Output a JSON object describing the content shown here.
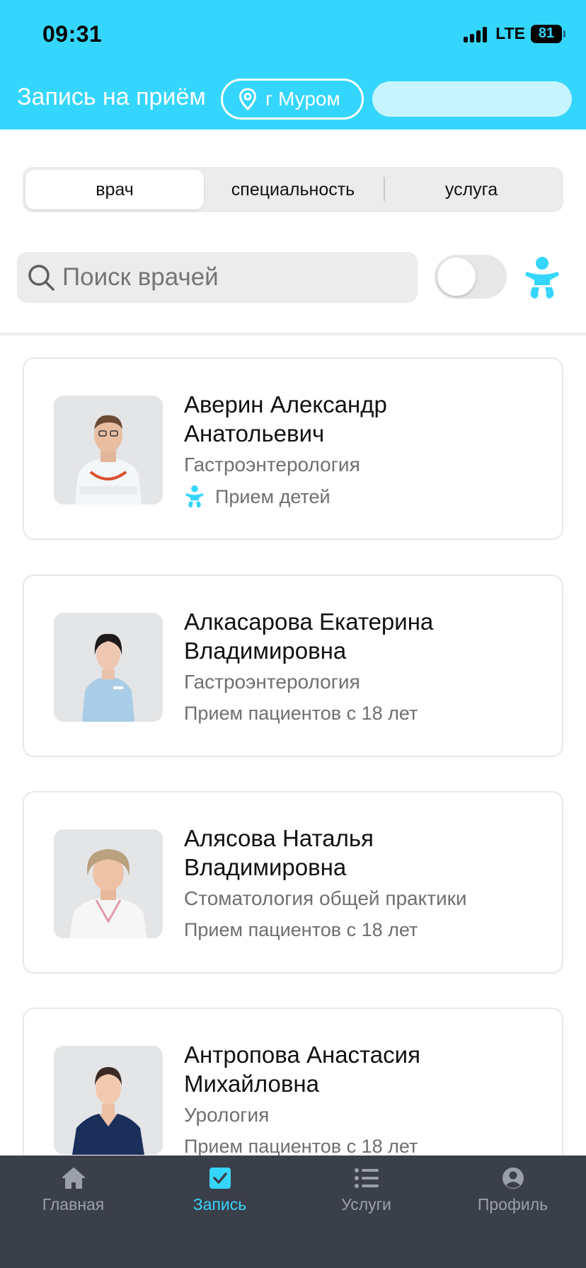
{
  "status": {
    "time": "09:31",
    "network": "LTE",
    "battery": "81"
  },
  "header": {
    "title": "Запись на приём",
    "city": "г Муром"
  },
  "segments": [
    {
      "label": "врач",
      "active": true
    },
    {
      "label": "специальность",
      "active": false
    },
    {
      "label": "услуга",
      "active": false
    }
  ],
  "search": {
    "placeholder": "Поиск врачей",
    "value": ""
  },
  "kids_toggle": {
    "on": false
  },
  "doctors": [
    {
      "name_line1": "Аверин Александр",
      "name_line2": "Анатольевич",
      "specialty": "Гастроэнтерология",
      "note": "Прием детей",
      "kids_icon": "child-icon"
    },
    {
      "name_line1": "Алкасарова Екатерина",
      "name_line2": "Владимировна",
      "specialty": "Гастроэнтерология",
      "note": "Прием пациентов с 18 лет"
    },
    {
      "name_line1": "Алясова Наталья",
      "name_line2": "Владимировна",
      "specialty": "Стоматология общей практики",
      "note": "Прием пациентов с 18 лет"
    },
    {
      "name_line1": "Антропова Анастасия",
      "name_line2": "Михайловна",
      "specialty": "Урология",
      "note": "Прием пациентов с 18 лет"
    }
  ],
  "tabbar": [
    {
      "label": "Главная",
      "icon": "home-icon",
      "active": false
    },
    {
      "label": "Запись",
      "icon": "checkbox-icon",
      "active": true
    },
    {
      "label": "Услуги",
      "icon": "list-icon",
      "active": false
    },
    {
      "label": "Профиль",
      "icon": "profile-icon",
      "active": false
    }
  ],
  "colors": {
    "accent": "#35d6fd",
    "tabbar_bg": "#3b3f4a",
    "muted": "#6f6f6f"
  }
}
